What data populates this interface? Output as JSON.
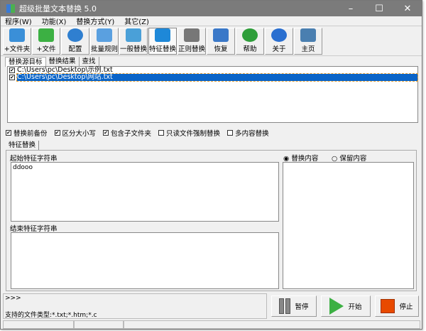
{
  "window": {
    "title": "超级批量文本替换 5.0",
    "minimize": "–",
    "maximize": "☐",
    "close": "✕"
  },
  "menu": [
    "程序(W)",
    "功能(X)",
    "替换方式(Y)",
    "其它(Z)"
  ],
  "toolbar": [
    {
      "label": "+文件夹",
      "color": "#3a8fd8"
    },
    {
      "label": "+文件",
      "color": "#3cb043"
    },
    {
      "label": "配置",
      "color": "#2f7fd0"
    },
    {
      "label": "批量规则",
      "color": "#5aa0e0"
    },
    {
      "label": "一般替换",
      "color": "#4aa0d8"
    },
    {
      "label": "特征替换",
      "color": "#1e88d8"
    },
    {
      "label": "正则替换",
      "color": "#777777"
    },
    {
      "label": "恢复",
      "color": "#3a78c8"
    },
    {
      "label": "帮助",
      "color": "#2e9e3a"
    },
    {
      "label": "关于",
      "color": "#2a6fd0"
    },
    {
      "label": "主页",
      "color": "#4a7fb0"
    }
  ],
  "tabs": [
    "替换源目标",
    "替换结果",
    "查找"
  ],
  "files": [
    {
      "path": "C:\\Users\\pc\\Desktop\\示例.txt",
      "checked": true
    },
    {
      "path": "C:\\Users\\pc\\Desktop\\网站.txt",
      "checked": true
    }
  ],
  "options": [
    {
      "label": "替换前备份",
      "checked": true
    },
    {
      "label": "区分大小写",
      "checked": true
    },
    {
      "label": "包含子文件夹",
      "checked": true
    },
    {
      "label": "只读文件强制替换",
      "checked": false
    },
    {
      "label": "多内容替换",
      "checked": false
    }
  ],
  "feature_tab": "特征替换",
  "start_label": "起始特征字符串",
  "start_value": "ddooo",
  "end_label": "结束特征字符串",
  "end_value": "",
  "radio": [
    {
      "label": "替换内容",
      "selected": true
    },
    {
      "label": "保留内容",
      "selected": false
    }
  ],
  "log": {
    "prompt": ">>>",
    "supported": "支持的文件类型:*.txt;*.htm;*.c"
  },
  "buttons": {
    "pause": "暂停",
    "start": "开始",
    "stop": "停止"
  }
}
